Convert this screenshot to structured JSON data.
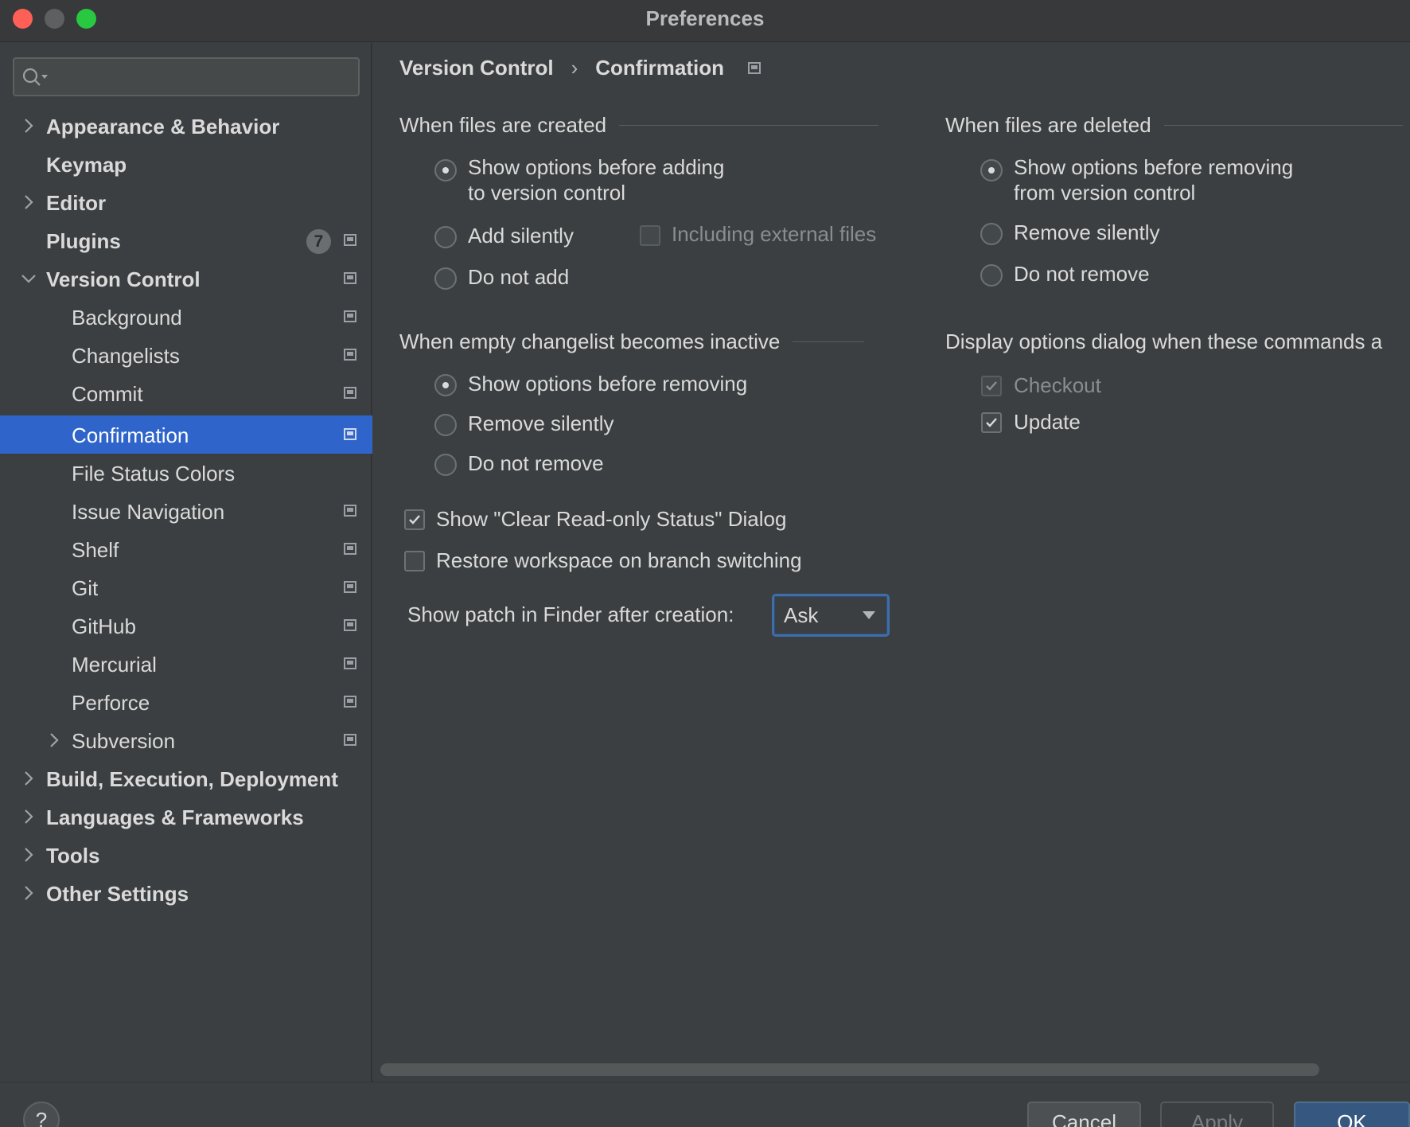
{
  "window": {
    "title": "Preferences"
  },
  "search": {
    "placeholder": ""
  },
  "sidebar": {
    "items": [
      {
        "label": "Appearance & Behavior"
      },
      {
        "label": "Keymap"
      },
      {
        "label": "Editor"
      },
      {
        "label": "Plugins",
        "badge": "7"
      },
      {
        "label": "Version Control"
      },
      {
        "label": "Background"
      },
      {
        "label": "Changelists"
      },
      {
        "label": "Commit"
      },
      {
        "label": "Confirmation"
      },
      {
        "label": "File Status Colors"
      },
      {
        "label": "Issue Navigation"
      },
      {
        "label": "Shelf"
      },
      {
        "label": "Git"
      },
      {
        "label": "GitHub"
      },
      {
        "label": "Mercurial"
      },
      {
        "label": "Perforce"
      },
      {
        "label": "Subversion"
      },
      {
        "label": "Build, Execution, Deployment"
      },
      {
        "label": "Languages & Frameworks"
      },
      {
        "label": "Tools"
      },
      {
        "label": "Other Settings"
      }
    ]
  },
  "breadcrumb": {
    "parent": "Version Control",
    "separator": "›",
    "current": "Confirmation"
  },
  "created": {
    "title": "When files are created",
    "opt1_line1": "Show options before adding",
    "opt1_line2": "to version control",
    "opt2": "Add silently",
    "opt2_extra": "Including external files",
    "opt3": "Do not add",
    "selected": "Show options before adding to version control"
  },
  "deleted": {
    "title": "When files are deleted",
    "opt1_line1": "Show options before removing",
    "opt1_line2": "from version control",
    "opt2": "Remove silently",
    "opt3": "Do not remove",
    "selected": "Show options before removing from version control"
  },
  "changelist": {
    "title": "When empty changelist becomes inactive",
    "opt1": "Show options before removing",
    "opt2": "Remove silently",
    "opt3": "Do not remove",
    "selected": "Show options before removing"
  },
  "commands": {
    "title": "Display options dialog when these commands a",
    "checkout": "Checkout",
    "update": "Update"
  },
  "checks": {
    "clear_readonly": "Show \"Clear Read-only Status\" Dialog",
    "restore_workspace": "Restore workspace on branch switching"
  },
  "patch": {
    "label": "Show patch in Finder after creation:",
    "value": "Ask"
  },
  "footer": {
    "help": "?",
    "cancel": "Cancel",
    "apply": "Apply",
    "ok": "OK"
  },
  "colors": {
    "selection": "#2f65ca",
    "ok_button": "#365880",
    "background": "#3c3f41"
  }
}
